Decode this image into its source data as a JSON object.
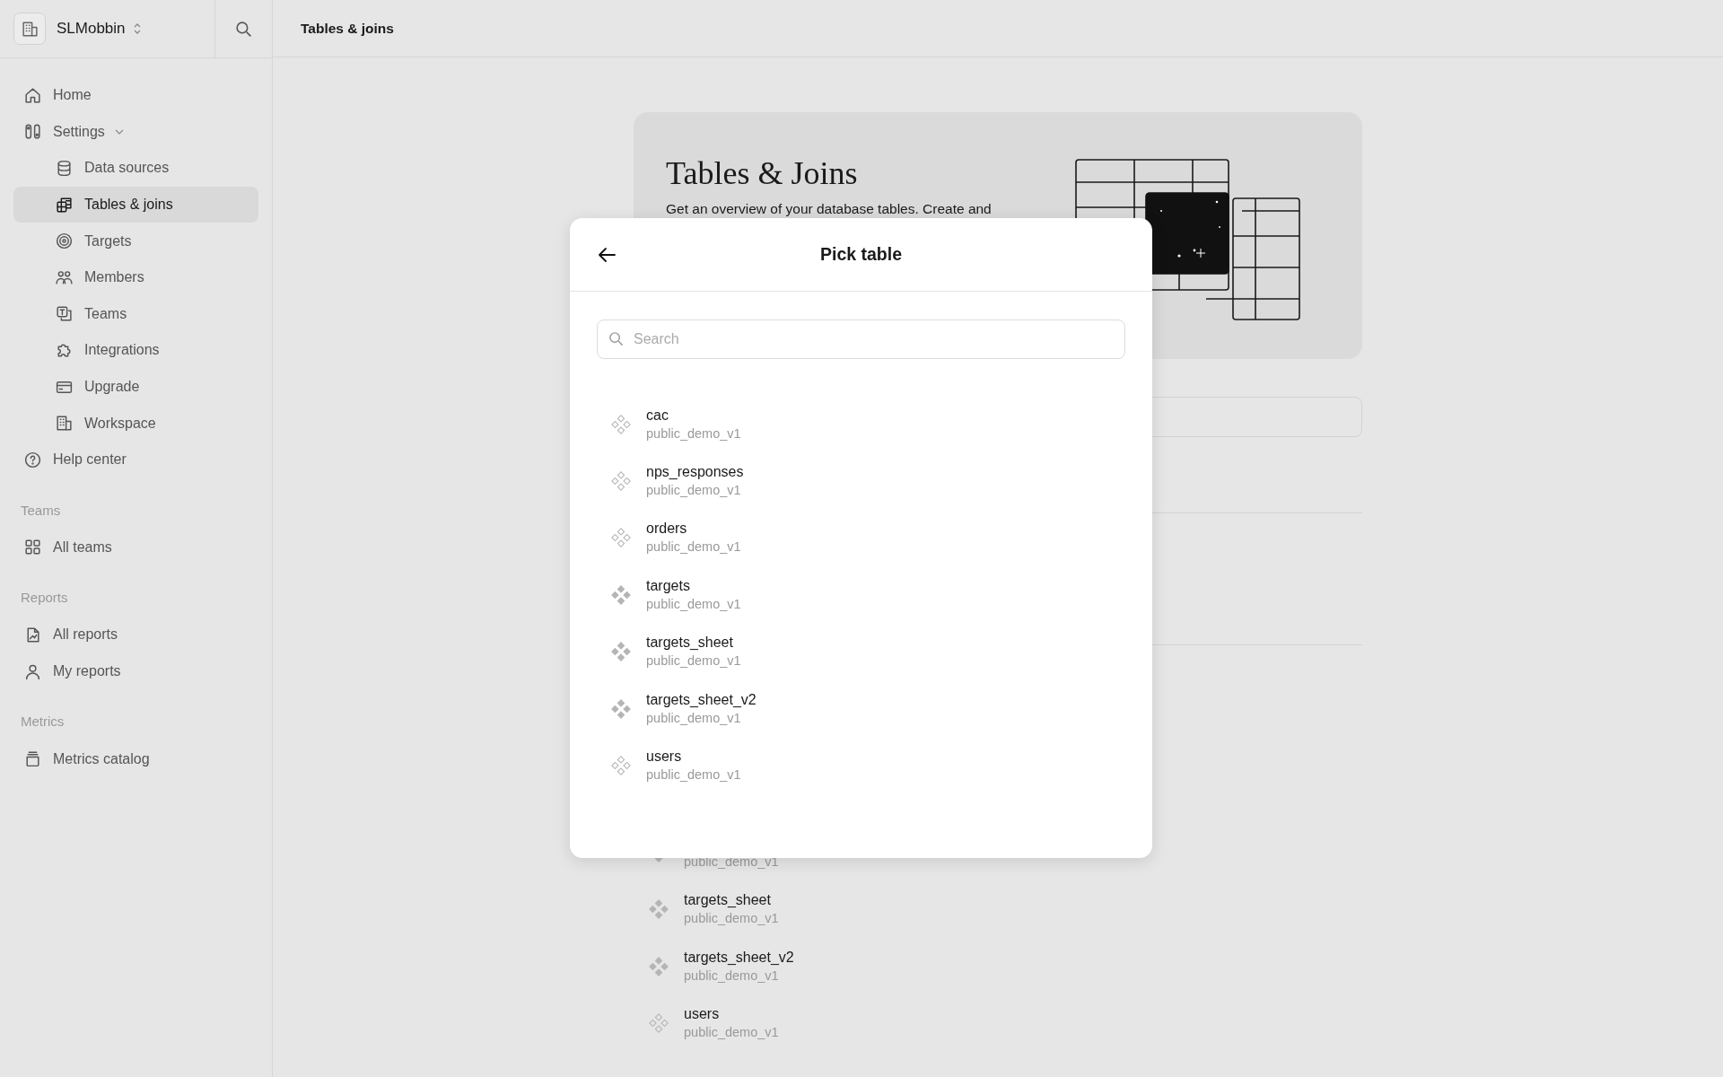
{
  "sidebar": {
    "workspace": "SLMobbin",
    "nav": [
      {
        "label": "Home",
        "selected": false
      },
      {
        "label": "Settings",
        "selected": false,
        "expanded": true,
        "children": [
          {
            "label": "Data sources",
            "selected": false
          },
          {
            "label": "Tables & joins",
            "selected": true
          },
          {
            "label": "Targets",
            "selected": false
          },
          {
            "label": "Members",
            "selected": false
          },
          {
            "label": "Teams",
            "selected": false
          },
          {
            "label": "Integrations",
            "selected": false
          },
          {
            "label": "Upgrade",
            "selected": false
          },
          {
            "label": "Workspace",
            "selected": false
          }
        ]
      },
      {
        "label": "Help center",
        "selected": false
      }
    ],
    "sections": [
      {
        "title": "Teams",
        "items": [
          {
            "label": "All teams",
            "selected": false
          }
        ]
      },
      {
        "title": "Reports",
        "items": [
          {
            "label": "All reports",
            "selected": false
          },
          {
            "label": "My reports",
            "selected": false
          }
        ]
      },
      {
        "title": "Metrics",
        "items": [
          {
            "label": "Metrics catalog",
            "selected": false
          }
        ]
      }
    ]
  },
  "header": {
    "title": "Tables & joins"
  },
  "banner": {
    "title": "Tables & Joins",
    "description": "Get an overview of your database tables. Create and"
  },
  "background_tables": [
    {
      "schema": "public_demo_v1",
      "filled": true
    },
    {
      "name": "targets_sheet",
      "schema": "public_demo_v1",
      "filled": true
    },
    {
      "name": "targets_sheet_v2",
      "schema": "public_demo_v1",
      "filled": true
    },
    {
      "name": "users",
      "schema": "public_demo_v1",
      "filled": false
    }
  ],
  "modal": {
    "title": "Pick table",
    "search": {
      "placeholder": "Search"
    },
    "tables": [
      {
        "name": "cac",
        "schema": "public_demo_v1",
        "filled": false
      },
      {
        "name": "nps_responses",
        "schema": "public_demo_v1",
        "filled": false
      },
      {
        "name": "orders",
        "schema": "public_demo_v1",
        "filled": false
      },
      {
        "name": "targets",
        "schema": "public_demo_v1",
        "filled": true
      },
      {
        "name": "targets_sheet",
        "schema": "public_demo_v1",
        "filled": true
      },
      {
        "name": "targets_sheet_v2",
        "schema": "public_demo_v1",
        "filled": true
      },
      {
        "name": "users",
        "schema": "public_demo_v1",
        "filled": false
      }
    ]
  }
}
